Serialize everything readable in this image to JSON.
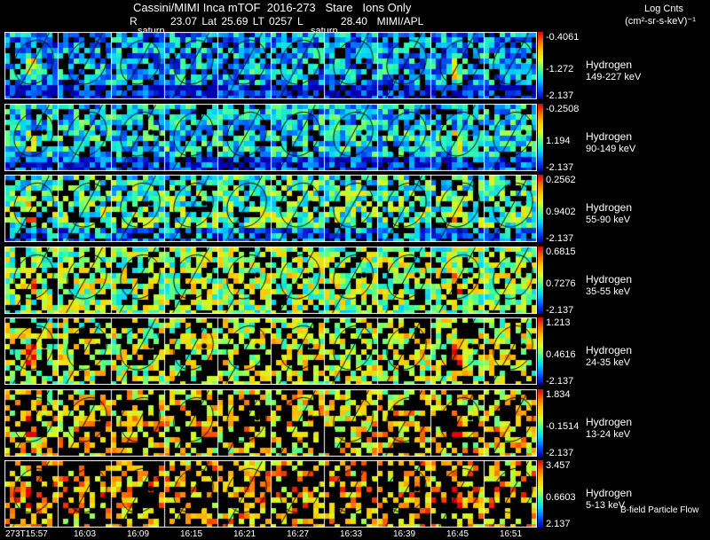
{
  "header": {
    "title": "Cassini/MIMI Inca mTOF  2016-273   Stare   Ions Only",
    "r_line": "R       23.07 Lat 25.69 LT 0257 L        28.40  MIMI/APL",
    "saturn_labels": [
      "saturn",
      "saturn"
    ]
  },
  "legend": {
    "title": "Log Cnts",
    "units": "(cm²-sr-s-keV)⁻¹",
    "flow_label": "B-field Particle Flow"
  },
  "panels": [
    {
      "species": "Hydrogen",
      "energy": "149-227 keV",
      "max": "-0.4061",
      "mid": "-1.272",
      "min": "-2.137",
      "level": 0.18
    },
    {
      "species": "Hydrogen",
      "energy": "90-149 keV",
      "max": "-0.2508",
      "mid": "1.194",
      "min": "-2.137",
      "level": 0.24
    },
    {
      "species": "Hydrogen",
      "energy": "55-90 keV",
      "max": "0.2562",
      "mid": "0.9402",
      "min": "-2.137",
      "level": 0.36
    },
    {
      "species": "Hydrogen",
      "energy": "35-55 keV",
      "max": "0.6815",
      "mid": "0.7276",
      "min": "-2.137",
      "level": 0.46
    },
    {
      "species": "Hydrogen",
      "energy": "24-35 keV",
      "max": "1.213",
      "mid": "0.4616",
      "min": "-2.137",
      "level": 0.52
    },
    {
      "species": "Hydrogen",
      "energy": "13-24 keV",
      "max": "1.834",
      "mid": "-0.1514",
      "min": "-2.137",
      "level": 0.62
    },
    {
      "species": "Hydrogen",
      "energy": "5-13 keV",
      "max": "3.457",
      "mid": "0.6603",
      "min": "2.137",
      "level": 0.68
    }
  ],
  "times": [
    "273T15:57",
    "16:03",
    "16:09",
    "16:15",
    "16:21",
    "16:27",
    "16:33",
    "16:39",
    "16:45",
    "16:51"
  ],
  "colors": {
    "background": "#000000",
    "grid": "#ffffff"
  }
}
